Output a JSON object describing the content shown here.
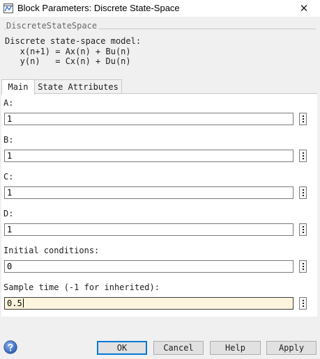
{
  "window": {
    "title": "Block Parameters: Discrete State-Space",
    "close_glyph": "✕"
  },
  "description": {
    "group_title": "DiscreteStateSpace",
    "lines": [
      "Discrete state-space model:",
      "   x(n+1) = Ax(n) + Bu(n)",
      "   y(n)   = Cx(n) + Du(n)"
    ]
  },
  "tabs": [
    {
      "label": "Main",
      "active": true
    },
    {
      "label": "State Attributes",
      "active": false
    }
  ],
  "params": [
    {
      "label": "A:",
      "value": "1"
    },
    {
      "label": "B:",
      "value": "1"
    },
    {
      "label": "C:",
      "value": "1"
    },
    {
      "label": "D:",
      "value": "1"
    },
    {
      "label": "Initial conditions:",
      "value": "0"
    },
    {
      "label": "Sample time (-1 for inherited):",
      "value": "0.5"
    }
  ],
  "buttons": {
    "ok": "OK",
    "cancel": "Cancel",
    "help": "Help",
    "apply": "Apply"
  },
  "icons": {
    "app": "simulink-block-icon",
    "help": "help-icon",
    "menu": "vertical-ellipsis-icon"
  },
  "colors": {
    "focused_field": "#fcf4dc",
    "default_button_border": "#0078d7",
    "help_icon": "#3a6fc4"
  }
}
